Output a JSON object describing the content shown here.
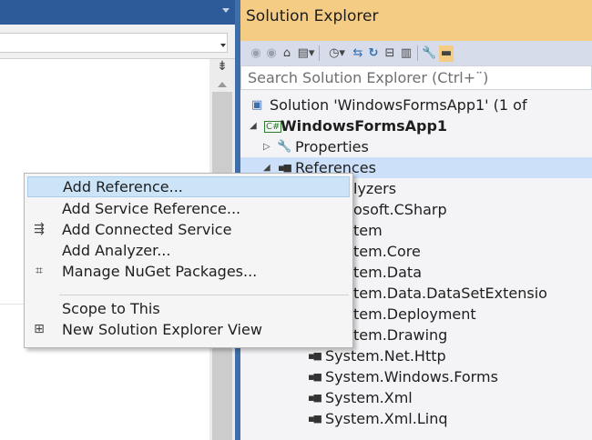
{
  "solution_explorer": {
    "title": "Solution Explorer",
    "search_placeholder": "Search Solution Explorer (Ctrl+¨)",
    "toolbar_icons": [
      "back-icon",
      "forward-icon",
      "home-icon",
      "switch-views-icon",
      "pending-changes-filter-icon",
      "sync-icon",
      "refresh-icon",
      "collapse-all-icon",
      "show-all-files-icon",
      "properties-icon",
      "preview-pin-icon"
    ],
    "tree": [
      {
        "label": "Solution 'WindowsFormsApp1' (1 of",
        "icon": "solution-icon",
        "level": 0
      },
      {
        "label": "WindowsFormsApp1",
        "icon": "csharp-project-icon",
        "level": 1,
        "expanded": true,
        "bold": true
      },
      {
        "label": "Properties",
        "icon": "wrench-icon",
        "level": 2,
        "expanded": false
      },
      {
        "label": "References",
        "icon": "references-icon",
        "level": 2,
        "expanded": true,
        "selected": true
      },
      {
        "label": "lyzers",
        "level": 3
      },
      {
        "label": "osoft.CSharp",
        "level": 3
      },
      {
        "label": "tem",
        "level": 3
      },
      {
        "label": "tem.Core",
        "level": 3
      },
      {
        "label": "tem.Data",
        "level": 3
      },
      {
        "label": "tem.Data.DataSetExtensio",
        "level": 3
      },
      {
        "label": "tem.Deployment",
        "level": 3
      },
      {
        "label": "tem.Drawing",
        "level": 3
      },
      {
        "label": "System.Net.Http",
        "icon": "reference-icon",
        "level": 3
      },
      {
        "label": "System.Windows.Forms",
        "icon": "reference-icon",
        "level": 3
      },
      {
        "label": "System.Xml",
        "icon": "reference-icon",
        "level": 3
      },
      {
        "label": "System.Xml.Linq",
        "icon": "reference-icon",
        "level": 3
      }
    ]
  },
  "context_menu": {
    "items": [
      {
        "label": "Add Reference...",
        "icon": "",
        "highlighted": true
      },
      {
        "label": "Add Service Reference...",
        "icon": ""
      },
      {
        "label": "Add Connected Service",
        "icon": "connected-service-icon"
      },
      {
        "label": "Add Analyzer...",
        "icon": ""
      },
      {
        "label": "Manage NuGet Packages...",
        "icon": "nuget-icon"
      },
      {
        "label": "Scope to This",
        "icon": ""
      },
      {
        "label": "New Solution Explorer View",
        "icon": "new-view-icon"
      }
    ]
  },
  "colors": {
    "title_bar_active": "#f5cc84",
    "menu_highlight": "#cce4f7",
    "tree_selection": "#cce0fa",
    "editor_header": "#2d5a99"
  }
}
